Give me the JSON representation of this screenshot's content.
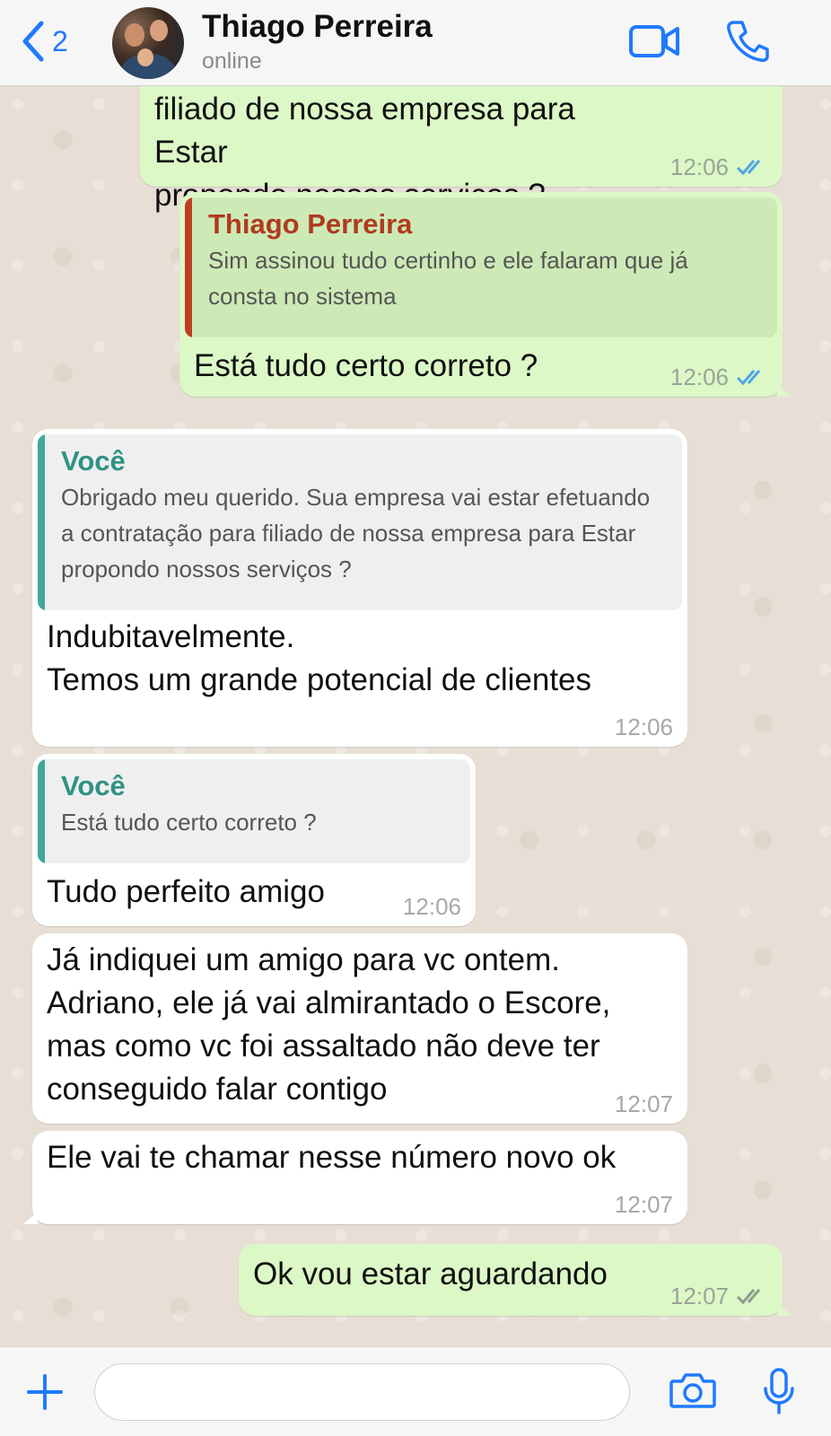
{
  "colors": {
    "accent": "#1f7aff",
    "outgoing_bubble": "#dcf8c6",
    "incoming_bubble": "#ffffff",
    "read_ticks": "#4fa5e6",
    "delivered_ticks": "#8f9c8f"
  },
  "header": {
    "back_count": "2",
    "contact_name": "Thiago Perreira",
    "status": "online",
    "icons": [
      "chevron-left-icon",
      "video-call-icon",
      "phone-icon"
    ]
  },
  "messages": [
    {
      "direction": "out",
      "text": "filiado de nossa empresa para Estar\npropondo nossos serviços ?",
      "time": "12:06",
      "status": "read"
    },
    {
      "direction": "out",
      "quote": {
        "author": "Thiago Perreira",
        "text": "Sim assinou tudo certinho e ele falaram que já consta no sistema"
      },
      "text": "Está tudo certo correto ?",
      "time": "12:06",
      "status": "read"
    },
    {
      "direction": "in",
      "quote": {
        "author": "Você",
        "text": "Obrigado meu querido. Sua empresa vai estar efetuando a contratação para filiado de nossa empresa para Estar propondo nossos serviços ?"
      },
      "text": "Indubitavelmente.\nTemos um grande potencial de clientes",
      "time": "12:06"
    },
    {
      "direction": "in",
      "quote": {
        "author": "Você",
        "text": "Está tudo certo correto ?"
      },
      "text": "Tudo perfeito amigo",
      "time": "12:06"
    },
    {
      "direction": "in",
      "text": "Já indiquei um amigo para vc ontem.\nAdriano, ele já vai almirantado o Escore,\nmas como vc foi assaltado não deve ter\nconseguido falar contigo",
      "time": "12:07"
    },
    {
      "direction": "in",
      "text": "Ele vai te chamar nesse número novo ok",
      "time": "12:07"
    },
    {
      "direction": "out",
      "text": "Ok vou estar aguardando",
      "time": "12:07",
      "status": "delivered"
    }
  ],
  "footer": {
    "input_placeholder": "",
    "icons": [
      "plus-icon",
      "camera-icon",
      "microphone-icon"
    ]
  }
}
